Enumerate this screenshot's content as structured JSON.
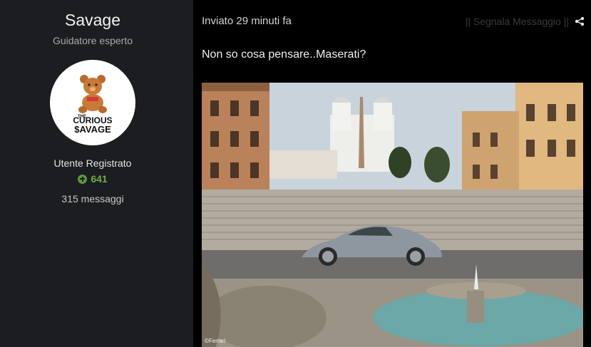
{
  "author": {
    "name": "Savage",
    "title": "Guidatore esperto",
    "avatar_text_top": "THE",
    "avatar_text_mid": "CURIOUS",
    "avatar_text_bottom": "$AVAGE",
    "group": "Utente Registrato",
    "reputation": "641",
    "posts": "315 messaggi"
  },
  "post": {
    "timestamp": "Inviato 29 minuti fa",
    "report_label": "|| Segnala Messaggio ||",
    "share_icon": "share-icon",
    "text": "Non so cosa pensare..Maserati?",
    "image_credit": "©Ferrari"
  },
  "colors": {
    "sidebar_bg": "#1c1d21",
    "page_bg": "#000000",
    "reputation_green": "#6cae47",
    "car": "#8e979f"
  }
}
